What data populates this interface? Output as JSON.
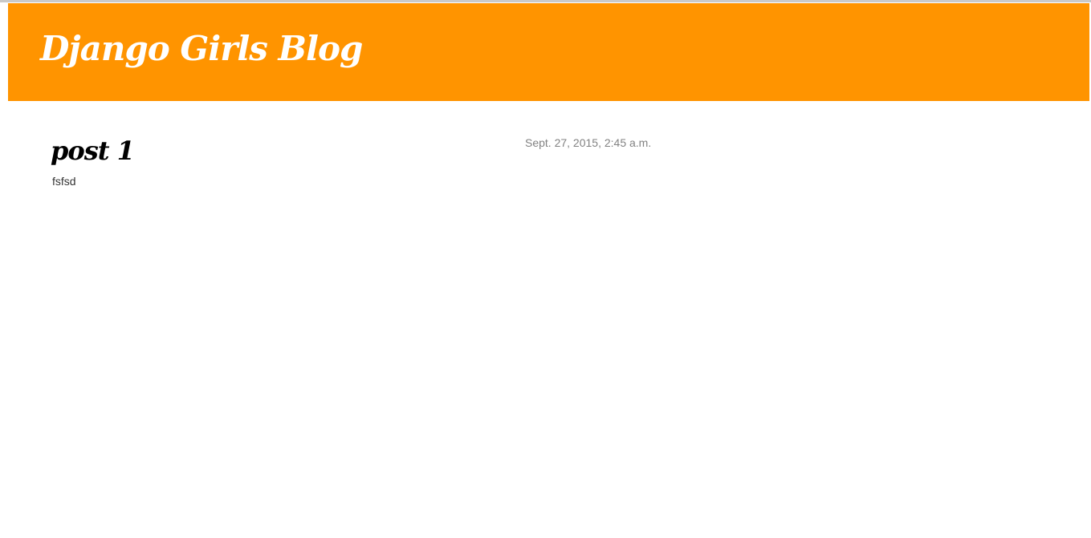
{
  "header": {
    "title": "Django Girls Blog",
    "background_color": "#ff9400",
    "title_color": "#ffffff"
  },
  "posts": [
    {
      "date": "Sept. 27, 2015, 2:45 a.m.",
      "title": "post 1",
      "text": "fsfsd"
    }
  ],
  "colors": {
    "date_text": "#828282",
    "body_text": "#333333"
  }
}
